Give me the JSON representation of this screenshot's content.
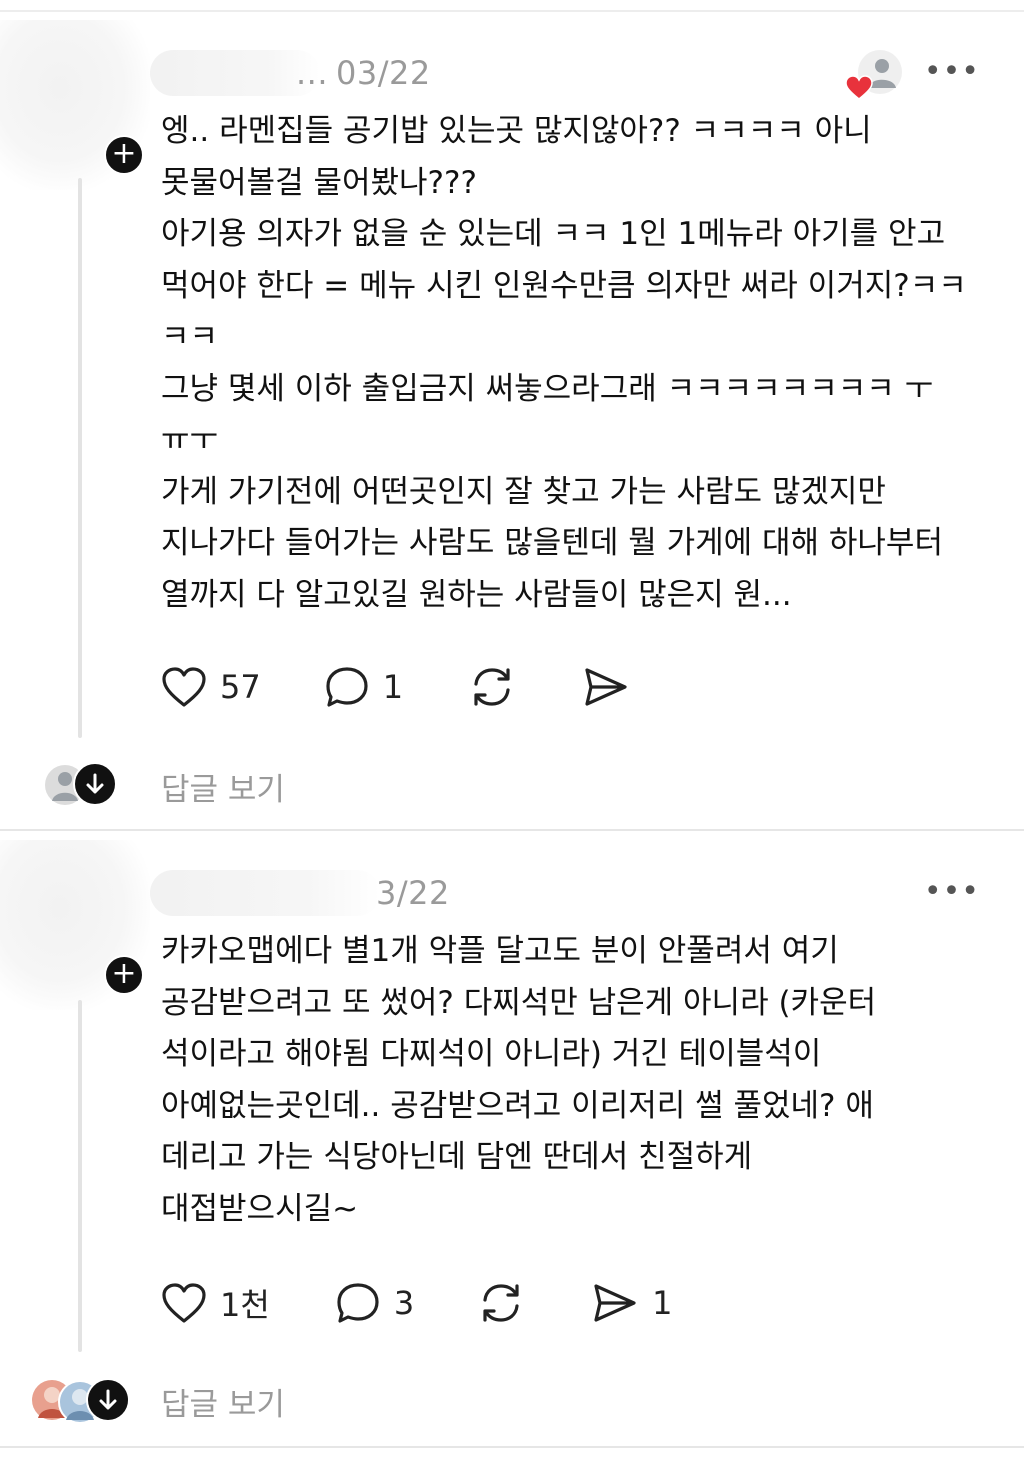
{
  "post1": {
    "date": "03/22",
    "name_fragment": "...",
    "more_label": "•••",
    "body": "엥.. 라멘집들 공기밥 있는곳 많지않아?? ㅋㅋㅋㅋ 아니\n못물어볼걸 물어봤나???\n아기용 의자가 없을 순 있는데 ㅋㅋ 1인 1메뉴라 아기를 안고\n먹어야 한다 = 메뉴 시킨 인원수만큼 의자만 써라 이거지?ㅋㅋ\nㅋㅋ\n그냥 몇세 이하 출입금지 써놓으라그래 ㅋㅋㅋㅋㅋㅋㅋㅋ ㅜ\nㅠㅜ\n가게 가기전에 어떤곳인지 잘 찾고 가는 사람도 많겠지만\n지나가다 들어가는 사람도 많을텐데 뭘 가게에 대해 하나부터\n열까지 다 알고있길 원하는 사람들이 많은지 원...",
    "likes": "57",
    "comments": "1",
    "replies_label": "답글 보기"
  },
  "post2": {
    "date": "3/22",
    "more_label": "•••",
    "body": "카카오맵에다 별1개 악플 달고도 분이 안풀려서 여기\n공감받으려고 또 썼어? 다찌석만 남은게 아니라 (카운터\n석이라고 해야됨 다찌석이 아니라) 거긴 테이블석이\n아예없는곳인데.. 공감받으려고 이리저리 썰 풀었네? 애\n데리고 가는 식당아닌데 담엔 딴데서 친절하게\n대접받으시길~",
    "likes": "1천",
    "comments": "3",
    "shares": "1",
    "replies_label": "답글 보기"
  },
  "colors": {
    "heart_badge": "#e8323c",
    "muted_text": "#9a9a9a"
  }
}
